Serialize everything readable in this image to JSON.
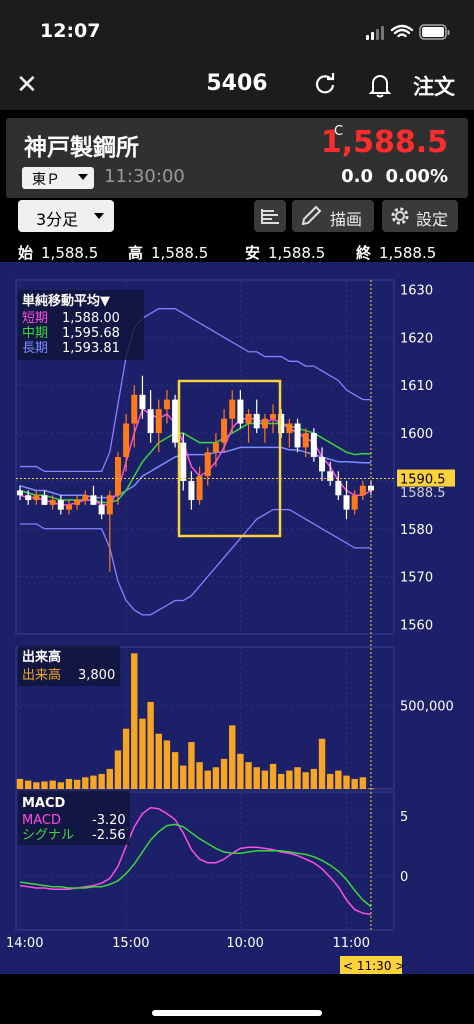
{
  "status_bar": {
    "time": "12:07"
  },
  "nav": {
    "title": "5406",
    "order_label": "注文"
  },
  "stock": {
    "name": "神戸製鋼所",
    "flag": "C",
    "price": "1,588.5",
    "market": "東Ｐ",
    "time": "11:30:00",
    "change": "0.0",
    "change_pct": "0.00%"
  },
  "toolbar": {
    "timeframe": "3分足",
    "draw_label": "描画",
    "settings_label": "設定"
  },
  "ohlc": {
    "open_label": "始",
    "open": "1,588.5",
    "high_label": "高",
    "high": "1,588.5",
    "low_label": "安",
    "low": "1,588.5",
    "close_label": "終",
    "close": "1,588.5"
  },
  "legend": {
    "ma_title": "単純移動平均▼",
    "short_label": "短期",
    "short_value": "1,588.00",
    "mid_label": "中期",
    "mid_value": "1,595.68",
    "long_label": "長期",
    "long_value": "1,593.81",
    "volume_title": "出来高",
    "volume_label": "出来高",
    "volume_value": "3,800",
    "macd_title": "MACD",
    "macd_label": "MACD",
    "macd_value": "-3.20",
    "signal_label": "シグナル",
    "signal_value": "-2.56"
  },
  "price_axis": [
    "1630",
    "1620",
    "1610",
    "1600",
    "1590.5",
    "1588.5",
    "1580",
    "1570",
    "1560"
  ],
  "volume_axis": [
    "500,000"
  ],
  "macd_axis": [
    "5",
    "0"
  ],
  "time_axis": [
    "14:00",
    "15:00",
    "10:00",
    "11:00"
  ],
  "cursor_time": "< 11:30 >",
  "colors": {
    "chart_bg": "#1b2068",
    "up": "#ff7a1a",
    "down": "#ffffff",
    "ma_short": "#ff4de6",
    "ma_mid": "#3cd63c",
    "ma_long": "#7f8cff",
    "bollinger": "#8a7fff",
    "highlight_box": "#ffd23c",
    "volume": "#f6a623",
    "price_red": "#ff2d2d"
  },
  "chart_data": [
    {
      "type": "candlestick",
      "title": "3分足",
      "ylim": [
        1558,
        1632
      ],
      "candles": [
        [
          1588,
          1589,
          1586,
          1587
        ],
        [
          1587,
          1588,
          1585,
          1586
        ],
        [
          1586,
          1588,
          1585,
          1587
        ],
        [
          1587,
          1588,
          1585,
          1585
        ],
        [
          1585,
          1587,
          1584,
          1586
        ],
        [
          1586,
          1587,
          1583,
          1584
        ],
        [
          1584,
          1586,
          1583,
          1585
        ],
        [
          1585,
          1587,
          1584,
          1586
        ],
        [
          1586,
          1588,
          1585,
          1587
        ],
        [
          1587,
          1589,
          1585,
          1585
        ],
        [
          1585,
          1587,
          1582,
          1583
        ],
        [
          1583,
          1588,
          1571,
          1587
        ],
        [
          1587,
          1596,
          1585,
          1595
        ],
        [
          1595,
          1604,
          1592,
          1602
        ],
        [
          1602,
          1610,
          1597,
          1608
        ],
        [
          1608,
          1612,
          1603,
          1605
        ],
        [
          1605,
          1609,
          1598,
          1600
        ],
        [
          1600,
          1607,
          1596,
          1605
        ],
        [
          1605,
          1609,
          1602,
          1607
        ],
        [
          1607,
          1608,
          1597,
          1598
        ],
        [
          1598,
          1600,
          1588,
          1590
        ],
        [
          1590,
          1592,
          1584,
          1586
        ],
        [
          1586,
          1593,
          1585,
          1591
        ],
        [
          1591,
          1597,
          1589,
          1596
        ],
        [
          1596,
          1600,
          1593,
          1598
        ],
        [
          1598,
          1605,
          1596,
          1603
        ],
        [
          1603,
          1609,
          1600,
          1607
        ],
        [
          1607,
          1609,
          1601,
          1602
        ],
        [
          1602,
          1605,
          1598,
          1604
        ],
        [
          1604,
          1607,
          1600,
          1601
        ],
        [
          1601,
          1604,
          1598,
          1603
        ],
        [
          1603,
          1606,
          1600,
          1604
        ],
        [
          1604,
          1605,
          1599,
          1600
        ],
        [
          1600,
          1603,
          1597,
          1602
        ],
        [
          1602,
          1603,
          1596,
          1597
        ],
        [
          1597,
          1601,
          1595,
          1600
        ],
        [
          1600,
          1601,
          1594,
          1595
        ],
        [
          1595,
          1597,
          1590,
          1592
        ],
        [
          1592,
          1594,
          1589,
          1590
        ],
        [
          1590,
          1592,
          1586,
          1587
        ],
        [
          1587,
          1590,
          1582,
          1584
        ],
        [
          1584,
          1588,
          1583,
          1587
        ],
        [
          1587,
          1590,
          1586,
          1589
        ],
        [
          1589,
          1590,
          1587,
          1588
        ]
      ],
      "ma_short": [
        1587,
        1586.5,
        1586.5,
        1586,
        1585.5,
        1585,
        1585,
        1585.5,
        1586,
        1586,
        1585,
        1585,
        1588,
        1594,
        1600,
        1605,
        1604,
        1603,
        1604,
        1602,
        1598,
        1593,
        1591,
        1592,
        1594,
        1597,
        1601,
        1603,
        1603,
        1603,
        1602,
        1603,
        1602,
        1601,
        1600,
        1599,
        1598,
        1595,
        1593,
        1590,
        1588,
        1587,
        1587,
        1588
      ],
      "ma_mid": [
        1588,
        1587.5,
        1587,
        1587,
        1586.5,
        1586,
        1586,
        1586,
        1586,
        1586,
        1585.5,
        1585.5,
        1586,
        1588,
        1591,
        1594,
        1596,
        1598,
        1599,
        1600,
        1600,
        1599,
        1598,
        1598,
        1598,
        1599,
        1600,
        1601,
        1602,
        1602,
        1602,
        1602,
        1602,
        1601.5,
        1601,
        1600.5,
        1600,
        1599,
        1598,
        1597,
        1596,
        1595.5,
        1595.7,
        1595.68
      ],
      "ma_long": [
        1589,
        1588.5,
        1588,
        1588,
        1587.5,
        1587,
        1587,
        1587,
        1587,
        1586.5,
        1586.5,
        1586.5,
        1587,
        1588,
        1589,
        1591,
        1592,
        1593,
        1594,
        1595,
        1595.5,
        1595.5,
        1595.5,
        1595.5,
        1596,
        1596,
        1596.5,
        1597,
        1597,
        1597,
        1597,
        1597,
        1597,
        1596.5,
        1596.5,
        1596,
        1595.5,
        1595,
        1594.5,
        1594,
        1594,
        1593.9,
        1593.8,
        1593.81
      ],
      "bb_upper": [
        1593,
        1593,
        1593,
        1592,
        1592,
        1592,
        1592,
        1592,
        1592,
        1592,
        1592,
        1596,
        1606,
        1616,
        1622,
        1624,
        1625,
        1626,
        1626,
        1626,
        1625,
        1624,
        1623,
        1622,
        1621,
        1620,
        1619,
        1618,
        1617,
        1617,
        1616,
        1616,
        1616,
        1615,
        1615,
        1614,
        1614,
        1613,
        1612,
        1611,
        1609,
        1608,
        1607,
        1607
      ],
      "bb_lower": [
        1581,
        1581,
        1581,
        1580,
        1580,
        1580,
        1580,
        1580,
        1580,
        1580,
        1580,
        1576,
        1569,
        1565,
        1563,
        1562,
        1562,
        1563,
        1564,
        1565,
        1565,
        1566,
        1568,
        1570,
        1572,
        1574,
        1576,
        1578,
        1580,
        1582,
        1583,
        1584,
        1584,
        1584,
        1583,
        1582,
        1581,
        1580,
        1579,
        1578,
        1577,
        1576,
        1576,
        1576
      ]
    },
    {
      "type": "bar",
      "title": "出来高",
      "series": [
        {
          "name": "出来高",
          "values": [
            60000,
            50000,
            40000,
            45000,
            50000,
            40000,
            60000,
            55000,
            70000,
            80000,
            90000,
            120000,
            230000,
            360000,
            810000,
            420000,
            520000,
            330000,
            290000,
            220000,
            140000,
            280000,
            160000,
            110000,
            130000,
            180000,
            380000,
            210000,
            160000,
            130000,
            110000,
            150000,
            90000,
            110000,
            130000,
            100000,
            120000,
            300000,
            90000,
            110000,
            80000,
            60000,
            70000,
            3800
          ]
        }
      ],
      "ylim": [
        0,
        800000
      ]
    },
    {
      "type": "line",
      "title": "MACD",
      "series": [
        {
          "name": "MACD",
          "values": [
            -0.8,
            -0.9,
            -1.0,
            -1.0,
            -1.1,
            -1.1,
            -1.1,
            -1.0,
            -0.9,
            -0.8,
            -0.6,
            -0.2,
            0.8,
            2.5,
            4.1,
            5.2,
            5.7,
            5.6,
            5.2,
            4.7,
            3.6,
            2.2,
            1.4,
            1.1,
            1.1,
            1.4,
            1.9,
            2.3,
            2.4,
            2.4,
            2.3,
            2.2,
            2.0,
            1.9,
            1.7,
            1.4,
            1.1,
            0.6,
            -0.1,
            -0.9,
            -2.0,
            -2.8,
            -3.1,
            -3.2
          ]
        },
        {
          "name": "シグナル",
          "values": [
            -0.5,
            -0.6,
            -0.7,
            -0.8,
            -0.9,
            -0.9,
            -1.0,
            -1.0,
            -1.0,
            -0.9,
            -0.9,
            -0.7,
            -0.4,
            0.2,
            1.0,
            2.0,
            3.0,
            3.7,
            4.2,
            4.3,
            4.1,
            3.6,
            3.1,
            2.7,
            2.3,
            2.0,
            1.9,
            1.9,
            2.0,
            2.1,
            2.1,
            2.1,
            2.1,
            2.0,
            1.9,
            1.8,
            1.6,
            1.3,
            0.9,
            0.4,
            -0.3,
            -1.2,
            -2.0,
            -2.56
          ]
        }
      ],
      "ylim": [
        -4.5,
        7
      ]
    }
  ]
}
